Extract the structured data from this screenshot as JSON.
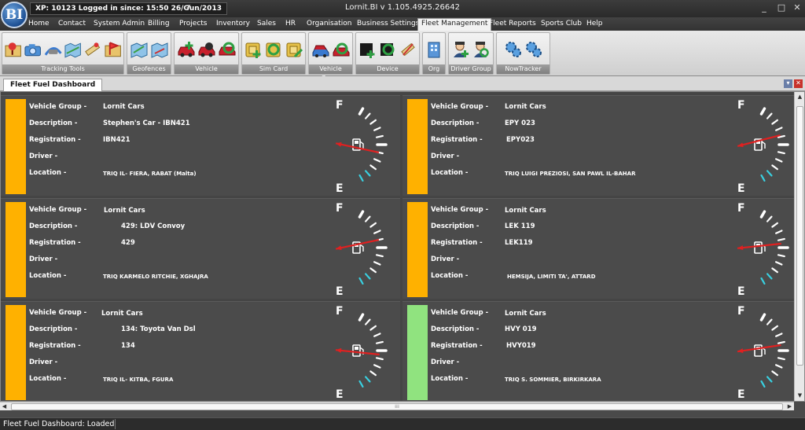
{
  "app": {
    "logo_text": "BI",
    "xp_info": "XP: 10123  Logged in since: 15:50 26/Gun/2013",
    "xp_dropdown": "▾",
    "title": "Lornit.BI v 1.105.4925.26642",
    "window_controls": [
      "_",
      "□",
      "✕"
    ]
  },
  "menu": {
    "items": [
      "Home",
      "Contact",
      "System Admin",
      "Billing",
      "Projects",
      "Inventory",
      "Sales",
      "HR",
      "Organisation",
      "Business Settings",
      "Fleet Management",
      "Fleet Reports",
      "Sports Club",
      "Help"
    ],
    "active": "Fleet Management"
  },
  "ribbon": {
    "groups": [
      {
        "label": "Tracking Tools",
        "icons": [
          "map-pin-icon",
          "camera-icon",
          "car-route-icon",
          "map-icon",
          "ruler-icon",
          "flag-icon"
        ]
      },
      {
        "label": "Geofences",
        "icons": [
          "geofence-map-icon",
          "geofence-edit-icon"
        ]
      },
      {
        "label": "Vehicle",
        "icons": [
          "add-vehicle-icon",
          "edit-vehicle-icon",
          "search-vehicle-icon"
        ]
      },
      {
        "label": "Sim Card",
        "icons": [
          "add-simcard-icon",
          "search-simcard-icon",
          "edit-simcard-icon"
        ]
      },
      {
        "label": "Vehicle Group",
        "icons": [
          "vehicle-group-icon",
          "search-vehicle-group-icon"
        ]
      },
      {
        "label": "Device",
        "icons": [
          "add-device-icon",
          "search-device-icon",
          "device-tool-icon"
        ]
      },
      {
        "label": "Org",
        "icons": [
          "building-icon"
        ]
      },
      {
        "label": "Driver Group",
        "icons": [
          "add-driver-icon",
          "search-driver-icon"
        ]
      },
      {
        "label": "NowTracker",
        "icons": [
          "gears-icon",
          "gears-settings-icon"
        ]
      }
    ]
  },
  "tab": {
    "label": "Fleet Fuel Dashboard",
    "pin_icon": "▾",
    "close_icon": "✕"
  },
  "labels": {
    "vehicle_group": "Vehicle Group -",
    "description": "Description -",
    "registration": "Registration -",
    "driver": "Driver -",
    "location": "Location -",
    "gauge_full": "F",
    "gauge_empty": "E"
  },
  "vehicles": [
    {
      "vehicle_group": "Lornit Cars",
      "description": "Stephen's Car - IBN421",
      "registration": "IBN421",
      "driver": "",
      "location": "TRIQ IL- FIERA, RABAT (Malta)",
      "status_color": "#ffb100",
      "fuel_level": 0.4
    },
    {
      "vehicle_group": "Lornit Cars",
      "description": "EPY 023",
      "registration": "EPY023",
      "driver": "",
      "location": "TRIQ LUIGI PREZIOSI, SAN PAWL IL-BAHAR",
      "status_color": "#ffb100",
      "fuel_level": 0.62
    },
    {
      "vehicle_group": "Lornit Cars",
      "description": "429: LDV Convoy",
      "registration": "429",
      "driver": "",
      "location": "TRIQ KARMELO RITCHIE, XGHAJRA",
      "status_color": "#ffb100",
      "fuel_level": 0.6
    },
    {
      "vehicle_group": "Lornit Cars",
      "description": "LEK 119",
      "registration": "LEK119",
      "driver": "",
      "location": "HEMSIJA, LIMITI TA', ATTARD",
      "status_color": "#ffb100",
      "fuel_level": 0.55
    },
    {
      "vehicle_group": "Lornit Cars",
      "description": "134: Toyota Van Dsl",
      "registration": "134",
      "driver": "",
      "location": "TRIQ IL- KITBA, FGURA",
      "status_color": "#ffb100",
      "fuel_level": 0.45
    },
    {
      "vehicle_group": "Lornit Cars",
      "description": "HVY 019",
      "registration": "HVY019",
      "driver": "",
      "location": "TRIQ S. SOMMIER, BIRKIRKARA",
      "status_color": "#90e37f",
      "fuel_level": 0.57
    }
  ],
  "status_bar": {
    "text": "Fleet Fuel Dashboard: Loaded"
  }
}
